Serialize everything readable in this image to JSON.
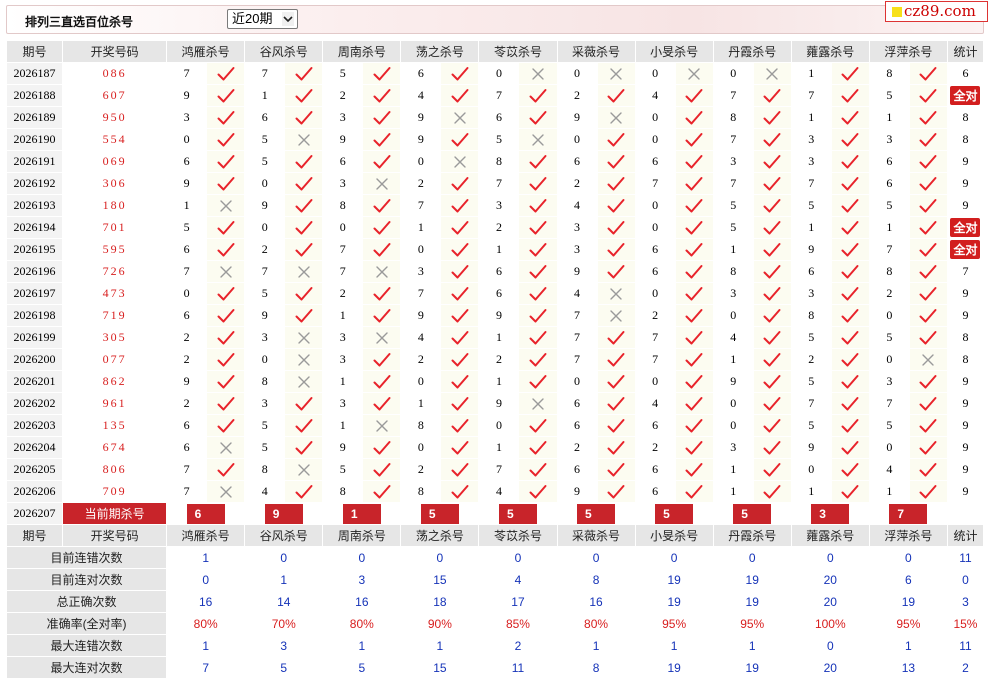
{
  "header": {
    "title": "排列三直选百位杀号",
    "period_select": "近20期",
    "logo": "cz89.com"
  },
  "columns": {
    "issue": "期号",
    "draw": "开奖号码",
    "experts": [
      "鸿雁杀号",
      "谷风杀号",
      "周南杀号",
      "荡之杀号",
      "苓苡杀号",
      "采薇杀号",
      "小旻杀号",
      "丹霞杀号",
      "蕹露杀号",
      "浮萍杀号"
    ],
    "stat": "统计"
  },
  "rows": [
    {
      "issue": "2026187",
      "draw": "086",
      "picks": [
        [
          7,
          "y"
        ],
        [
          7,
          "y"
        ],
        [
          5,
          "y"
        ],
        [
          6,
          "y"
        ],
        [
          0,
          "n"
        ],
        [
          0,
          "n"
        ],
        [
          0,
          "n"
        ],
        [
          0,
          "n"
        ],
        [
          1,
          "y"
        ],
        [
          8,
          "y"
        ]
      ],
      "stat": "6"
    },
    {
      "issue": "2026188",
      "draw": "607",
      "picks": [
        [
          9,
          "y"
        ],
        [
          1,
          "y"
        ],
        [
          2,
          "y"
        ],
        [
          4,
          "y"
        ],
        [
          7,
          "y"
        ],
        [
          2,
          "y"
        ],
        [
          4,
          "y"
        ],
        [
          7,
          "y"
        ],
        [
          7,
          "y"
        ],
        [
          5,
          "y"
        ]
      ],
      "stat": "全对"
    },
    {
      "issue": "2026189",
      "draw": "950",
      "picks": [
        [
          3,
          "y"
        ],
        [
          6,
          "y"
        ],
        [
          3,
          "y"
        ],
        [
          9,
          "n"
        ],
        [
          6,
          "y"
        ],
        [
          9,
          "n"
        ],
        [
          0,
          "y"
        ],
        [
          8,
          "y"
        ],
        [
          1,
          "y"
        ],
        [
          1,
          "y"
        ]
      ],
      "stat": "8"
    },
    {
      "issue": "2026190",
      "draw": "554",
      "picks": [
        [
          0,
          "y"
        ],
        [
          5,
          "n"
        ],
        [
          9,
          "y"
        ],
        [
          9,
          "y"
        ],
        [
          5,
          "n"
        ],
        [
          0,
          "y"
        ],
        [
          0,
          "y"
        ],
        [
          7,
          "y"
        ],
        [
          3,
          "y"
        ],
        [
          3,
          "y"
        ]
      ],
      "stat": "8"
    },
    {
      "issue": "2026191",
      "draw": "069",
      "picks": [
        [
          6,
          "y"
        ],
        [
          5,
          "y"
        ],
        [
          6,
          "y"
        ],
        [
          0,
          "n"
        ],
        [
          8,
          "y"
        ],
        [
          6,
          "y"
        ],
        [
          6,
          "y"
        ],
        [
          3,
          "y"
        ],
        [
          3,
          "y"
        ],
        [
          6,
          "y"
        ]
      ],
      "stat": "9"
    },
    {
      "issue": "2026192",
      "draw": "306",
      "picks": [
        [
          9,
          "y"
        ],
        [
          0,
          "y"
        ],
        [
          3,
          "n"
        ],
        [
          2,
          "y"
        ],
        [
          7,
          "y"
        ],
        [
          2,
          "y"
        ],
        [
          7,
          "y"
        ],
        [
          7,
          "y"
        ],
        [
          7,
          "y"
        ],
        [
          6,
          "y"
        ]
      ],
      "stat": "9"
    },
    {
      "issue": "2026193",
      "draw": "180",
      "picks": [
        [
          1,
          "n"
        ],
        [
          9,
          "y"
        ],
        [
          8,
          "y"
        ],
        [
          7,
          "y"
        ],
        [
          3,
          "y"
        ],
        [
          4,
          "y"
        ],
        [
          0,
          "y"
        ],
        [
          5,
          "y"
        ],
        [
          5,
          "y"
        ],
        [
          5,
          "y"
        ]
      ],
      "stat": "9"
    },
    {
      "issue": "2026194",
      "draw": "701",
      "picks": [
        [
          5,
          "y"
        ],
        [
          0,
          "y"
        ],
        [
          0,
          "y"
        ],
        [
          1,
          "y"
        ],
        [
          2,
          "y"
        ],
        [
          3,
          "y"
        ],
        [
          0,
          "y"
        ],
        [
          5,
          "y"
        ],
        [
          1,
          "y"
        ],
        [
          1,
          "y"
        ]
      ],
      "stat": "全对"
    },
    {
      "issue": "2026195",
      "draw": "595",
      "picks": [
        [
          6,
          "y"
        ],
        [
          2,
          "y"
        ],
        [
          7,
          "y"
        ],
        [
          0,
          "y"
        ],
        [
          1,
          "y"
        ],
        [
          3,
          "y"
        ],
        [
          6,
          "y"
        ],
        [
          1,
          "y"
        ],
        [
          9,
          "y"
        ],
        [
          7,
          "y"
        ]
      ],
      "stat": "全对"
    },
    {
      "issue": "2026196",
      "draw": "726",
      "picks": [
        [
          7,
          "n"
        ],
        [
          7,
          "n"
        ],
        [
          7,
          "n"
        ],
        [
          3,
          "y"
        ],
        [
          6,
          "y"
        ],
        [
          9,
          "y"
        ],
        [
          6,
          "y"
        ],
        [
          8,
          "y"
        ],
        [
          6,
          "y"
        ],
        [
          8,
          "y"
        ]
      ],
      "stat": "7"
    },
    {
      "issue": "2026197",
      "draw": "473",
      "picks": [
        [
          0,
          "y"
        ],
        [
          5,
          "y"
        ],
        [
          2,
          "y"
        ],
        [
          7,
          "y"
        ],
        [
          6,
          "y"
        ],
        [
          4,
          "n"
        ],
        [
          0,
          "y"
        ],
        [
          3,
          "y"
        ],
        [
          3,
          "y"
        ],
        [
          2,
          "y"
        ]
      ],
      "stat": "9"
    },
    {
      "issue": "2026198",
      "draw": "719",
      "picks": [
        [
          6,
          "y"
        ],
        [
          9,
          "y"
        ],
        [
          1,
          "y"
        ],
        [
          9,
          "y"
        ],
        [
          9,
          "y"
        ],
        [
          7,
          "n"
        ],
        [
          2,
          "y"
        ],
        [
          0,
          "y"
        ],
        [
          8,
          "y"
        ],
        [
          0,
          "y"
        ]
      ],
      "stat": "9"
    },
    {
      "issue": "2026199",
      "draw": "305",
      "picks": [
        [
          2,
          "y"
        ],
        [
          3,
          "n"
        ],
        [
          3,
          "n"
        ],
        [
          4,
          "y"
        ],
        [
          1,
          "y"
        ],
        [
          7,
          "y"
        ],
        [
          7,
          "y"
        ],
        [
          4,
          "y"
        ],
        [
          5,
          "y"
        ],
        [
          5,
          "y"
        ]
      ],
      "stat": "8"
    },
    {
      "issue": "2026200",
      "draw": "077",
      "picks": [
        [
          2,
          "y"
        ],
        [
          0,
          "n"
        ],
        [
          3,
          "y"
        ],
        [
          2,
          "y"
        ],
        [
          2,
          "y"
        ],
        [
          7,
          "y"
        ],
        [
          7,
          "y"
        ],
        [
          1,
          "y"
        ],
        [
          2,
          "y"
        ],
        [
          0,
          "n"
        ]
      ],
      "stat": "8"
    },
    {
      "issue": "2026201",
      "draw": "862",
      "picks": [
        [
          9,
          "y"
        ],
        [
          8,
          "n"
        ],
        [
          1,
          "y"
        ],
        [
          0,
          "y"
        ],
        [
          1,
          "y"
        ],
        [
          0,
          "y"
        ],
        [
          0,
          "y"
        ],
        [
          9,
          "y"
        ],
        [
          5,
          "y"
        ],
        [
          3,
          "y"
        ]
      ],
      "stat": "9"
    },
    {
      "issue": "2026202",
      "draw": "961",
      "picks": [
        [
          2,
          "y"
        ],
        [
          3,
          "y"
        ],
        [
          3,
          "y"
        ],
        [
          1,
          "y"
        ],
        [
          9,
          "n"
        ],
        [
          6,
          "y"
        ],
        [
          4,
          "y"
        ],
        [
          0,
          "y"
        ],
        [
          7,
          "y"
        ],
        [
          7,
          "y"
        ]
      ],
      "stat": "9"
    },
    {
      "issue": "2026203",
      "draw": "135",
      "picks": [
        [
          6,
          "y"
        ],
        [
          5,
          "y"
        ],
        [
          1,
          "n"
        ],
        [
          8,
          "y"
        ],
        [
          0,
          "y"
        ],
        [
          6,
          "y"
        ],
        [
          6,
          "y"
        ],
        [
          0,
          "y"
        ],
        [
          5,
          "y"
        ],
        [
          5,
          "y"
        ]
      ],
      "stat": "9"
    },
    {
      "issue": "2026204",
      "draw": "674",
      "picks": [
        [
          6,
          "n"
        ],
        [
          5,
          "y"
        ],
        [
          9,
          "y"
        ],
        [
          0,
          "y"
        ],
        [
          1,
          "y"
        ],
        [
          2,
          "y"
        ],
        [
          2,
          "y"
        ],
        [
          3,
          "y"
        ],
        [
          9,
          "y"
        ],
        [
          0,
          "y"
        ]
      ],
      "stat": "9"
    },
    {
      "issue": "2026205",
      "draw": "806",
      "picks": [
        [
          7,
          "y"
        ],
        [
          8,
          "n"
        ],
        [
          5,
          "y"
        ],
        [
          2,
          "y"
        ],
        [
          7,
          "y"
        ],
        [
          6,
          "y"
        ],
        [
          6,
          "y"
        ],
        [
          1,
          "y"
        ],
        [
          0,
          "y"
        ],
        [
          4,
          "y"
        ]
      ],
      "stat": "9"
    },
    {
      "issue": "2026206",
      "draw": "709",
      "picks": [
        [
          7,
          "n"
        ],
        [
          4,
          "y"
        ],
        [
          8,
          "y"
        ],
        [
          8,
          "y"
        ],
        [
          4,
          "y"
        ],
        [
          9,
          "y"
        ],
        [
          6,
          "y"
        ],
        [
          1,
          "y"
        ],
        [
          1,
          "y"
        ],
        [
          1,
          "y"
        ]
      ],
      "stat": "9"
    }
  ],
  "current": {
    "issue": "2026207",
    "label": "当前期杀号",
    "kills": [
      "6",
      "9",
      "1",
      "5",
      "5",
      "5",
      "5",
      "5",
      "3",
      "7"
    ]
  },
  "stats": [
    {
      "label": "目前连错次数",
      "values": [
        "1",
        "0",
        "0",
        "0",
        "0",
        "0",
        "0",
        "0",
        "0",
        "0"
      ],
      "stat": "11",
      "red": false
    },
    {
      "label": "目前连对次数",
      "values": [
        "0",
        "1",
        "3",
        "15",
        "4",
        "8",
        "19",
        "19",
        "20",
        "6"
      ],
      "stat": "0",
      "red": false
    },
    {
      "label": "总正确次数",
      "values": [
        "16",
        "14",
        "16",
        "18",
        "17",
        "16",
        "19",
        "19",
        "20",
        "19"
      ],
      "stat": "3",
      "red": false
    },
    {
      "label": "准确率(全对率)",
      "values": [
        "80%",
        "70%",
        "80%",
        "90%",
        "85%",
        "80%",
        "95%",
        "95%",
        "100%",
        "95%"
      ],
      "stat": "15%",
      "red": true
    },
    {
      "label": "最大连错次数",
      "values": [
        "1",
        "3",
        "1",
        "1",
        "2",
        "1",
        "1",
        "1",
        "0",
        "1"
      ],
      "stat": "11",
      "red": false
    },
    {
      "label": "最大连对次数",
      "values": [
        "7",
        "5",
        "5",
        "15",
        "11",
        "8",
        "19",
        "19",
        "20",
        "13"
      ],
      "stat": "2",
      "red": false
    }
  ],
  "icons": {
    "correct": "red-check-icon",
    "wrong": "gray-cross-icon"
  },
  "colors": {
    "check": "#e8232b",
    "cross": "#9a9a9a",
    "highlight_red": "#c8242a",
    "stat_blue": "#1533b8"
  }
}
